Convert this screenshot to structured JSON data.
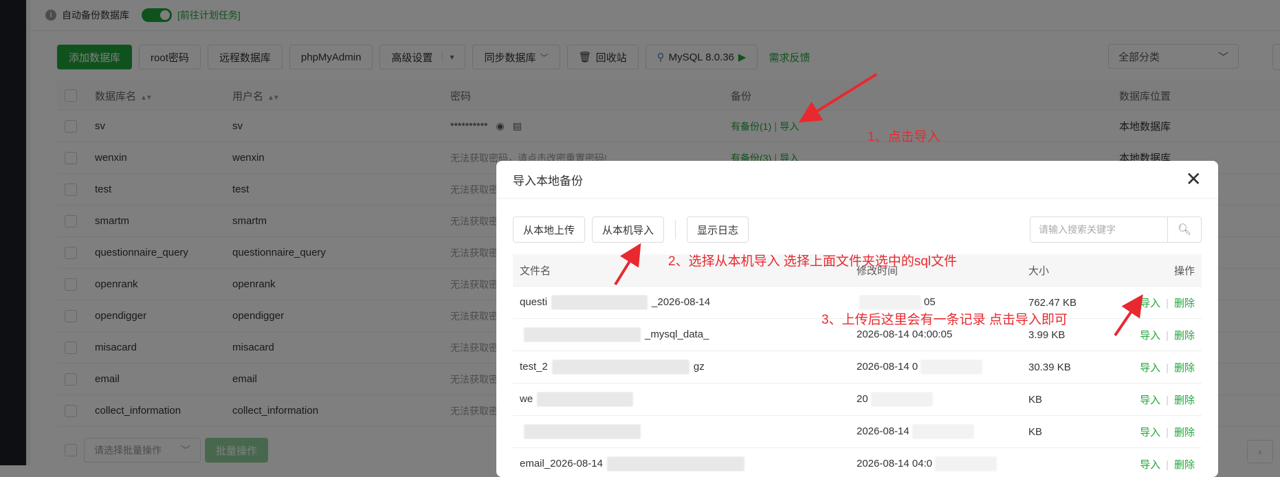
{
  "topbar": {
    "label": "自动备份数据库",
    "link": "[前往计划任务]"
  },
  "toolbar": {
    "add_db": "添加数据库",
    "root_pwd": "root密码",
    "remote_db": "远程数据库",
    "phpmyadmin": "phpMyAdmin",
    "advanced": "高级设置",
    "sync_db": "同步数据库",
    "recycle": "回收站",
    "mysql": "MySQL 8.0.36",
    "feedback": "需求反馈",
    "category": "全部分类"
  },
  "table": {
    "headers": {
      "name": "数据库名",
      "user": "用户名",
      "password": "密码",
      "backup": "备份",
      "location": "数据库位置"
    },
    "rows": [
      {
        "name": "sv",
        "user": "sv",
        "password": "**********",
        "backup": "有备份(1)",
        "sep": " | ",
        "import": "导入",
        "location": "本地数据库"
      },
      {
        "name": "wenxin",
        "user": "wenxin",
        "password": "无法获取密码，请点击改密重置密码!",
        "backup": "有备份(3)",
        "sep": " | ",
        "import": "导入",
        "location": "本地数据库"
      },
      {
        "name": "test",
        "user": "test",
        "password": "无法获取密"
      },
      {
        "name": "smartm",
        "user": "smartm",
        "password": "无法获取密"
      },
      {
        "name": "questionnaire_query",
        "user": "questionnaire_query",
        "password": "无法获取密"
      },
      {
        "name": "openrank",
        "user": "openrank",
        "password": "无法获取密"
      },
      {
        "name": "opendigger",
        "user": "opendigger",
        "password": "无法获取密"
      },
      {
        "name": "misacard",
        "user": "misacard",
        "password": "无法获取密"
      },
      {
        "name": "email",
        "user": "email",
        "password": "无法获取密"
      },
      {
        "name": "collect_information",
        "user": "collect_information",
        "password": "无法获取密"
      }
    ]
  },
  "bottom": {
    "batch_select_placeholder": "请选择批量操作",
    "batch_btn": "批量操作"
  },
  "annotations": {
    "step1": "1、点击导入",
    "step2": "2、选择从本机导入 选择上面文件夹选中的sql文件",
    "step3": "3、上传后这里会有一条记录 点击导入即可"
  },
  "modal": {
    "title": "导入本地备份",
    "buttons": {
      "upload_local": "从本地上传",
      "import_local": "从本机导入",
      "show_log": "显示日志"
    },
    "search_placeholder": "请输入搜索关键字",
    "headers": {
      "file": "文件名",
      "time": "修改时间",
      "size": "大小",
      "ops": "操作"
    },
    "op_import": "导入",
    "op_delete": "删除",
    "rows": [
      {
        "file": "questi",
        "file_tail": "_2026-08-14",
        "time": "",
        "time_tail": "05",
        "size": "762.47 KB"
      },
      {
        "file": "",
        "file_tail": "_mysql_data_",
        "time": "2026-08-14 04:00:05",
        "time_tail": "",
        "size": "3.99 KB"
      },
      {
        "file": "test_2",
        "file_tail": "gz",
        "time": "2026-08-14 0",
        "time_tail": "",
        "size": "30.39 KB"
      },
      {
        "file": "we",
        "file_tail": "",
        "time": "20",
        "time_tail": "",
        "size": "KB"
      },
      {
        "file": "",
        "file_tail": "",
        "time": "2026-08-14",
        "time_tail": "",
        "size": "KB"
      },
      {
        "file": "email_2026-08-14",
        "file_tail": "",
        "time": "2026-08-14 04:0",
        "time_tail": "",
        "size": ""
      }
    ]
  }
}
